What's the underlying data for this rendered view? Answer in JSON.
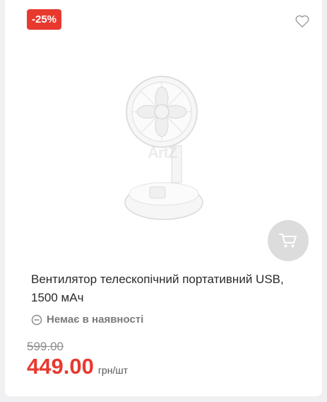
{
  "product": {
    "discount_badge": "-25%",
    "title": "Вентилятор телескопічний портативний USB, 1500 мАч",
    "stock_status": "Немає в наявності",
    "old_price": "599.00",
    "new_price": "449.00",
    "price_unit": "грн/шт",
    "watermark": "ArtZ"
  },
  "icons": {
    "favorite": "heart-outline-icon",
    "cart": "shopping-cart-icon",
    "stock": "minus-circle-icon"
  },
  "colors": {
    "accent": "#e8392f",
    "muted_button": "#dcdcdc"
  }
}
